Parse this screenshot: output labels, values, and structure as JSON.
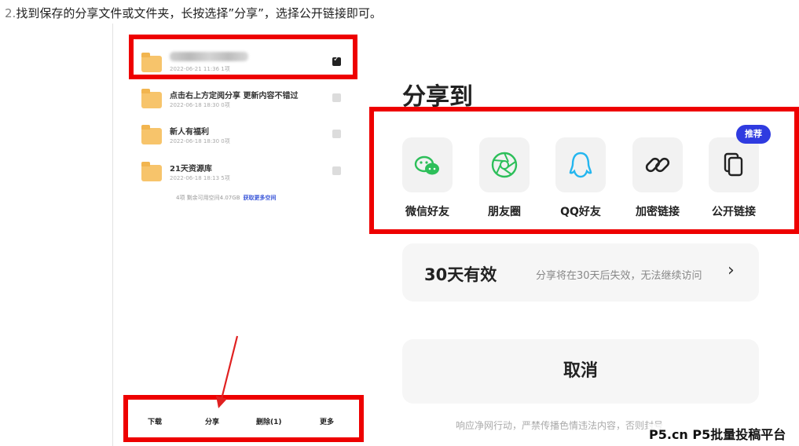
{
  "instruction": {
    "number": "2.",
    "text": "找到保存的分享文件或文件夹，长按选择”分享”，选择公开链接即可。"
  },
  "files": [
    {
      "name": "",
      "meta": "2022-06-21 11:36  1项",
      "checked": true
    },
    {
      "name": "点击右上方定阅分享 更新内容不错过",
      "meta": "2022-06-18 18:30  0项",
      "checked": false
    },
    {
      "name": "新人有福利",
      "meta": "2022-06-18 18:30  0项",
      "checked": false
    },
    {
      "name": "21天资源库",
      "meta": "2022-06-18 18:13  5项",
      "checked": false
    }
  ],
  "storage": {
    "text": "4项 剩余可用空间4.07GB",
    "link": "获取更多空间"
  },
  "bottom_bar": {
    "download": "下载",
    "share": "分享",
    "delete": "删除(1)",
    "more": "更多"
  },
  "share_sheet": {
    "title": "分享到",
    "badge": "推荐",
    "options": [
      {
        "label": "微信好友",
        "icon": "wechat-icon",
        "color": "#2dbf5a"
      },
      {
        "label": "朋友圈",
        "icon": "moments-icon",
        "color": "#2dbf5a"
      },
      {
        "label": "QQ好友",
        "icon": "qq-icon",
        "color": "#24b6ef"
      },
      {
        "label": "加密链接",
        "icon": "link-icon",
        "color": "#222222"
      },
      {
        "label": "公开链接",
        "icon": "copy-icon",
        "color": "#222222"
      }
    ],
    "validity": {
      "title": "30天有效",
      "desc": "分享将在30天后失效，无法继续访问",
      "chevron": "›"
    },
    "cancel": "取消",
    "notice": "响应净网行动，严禁传播色情违法内容，否则封号"
  },
  "watermark": "P5.cn P5批量投稿平台",
  "colors": {
    "highlight": "#ee0000",
    "badge": "#2f3be0",
    "folder": "#f7c46b",
    "arrow": "#e02020"
  }
}
